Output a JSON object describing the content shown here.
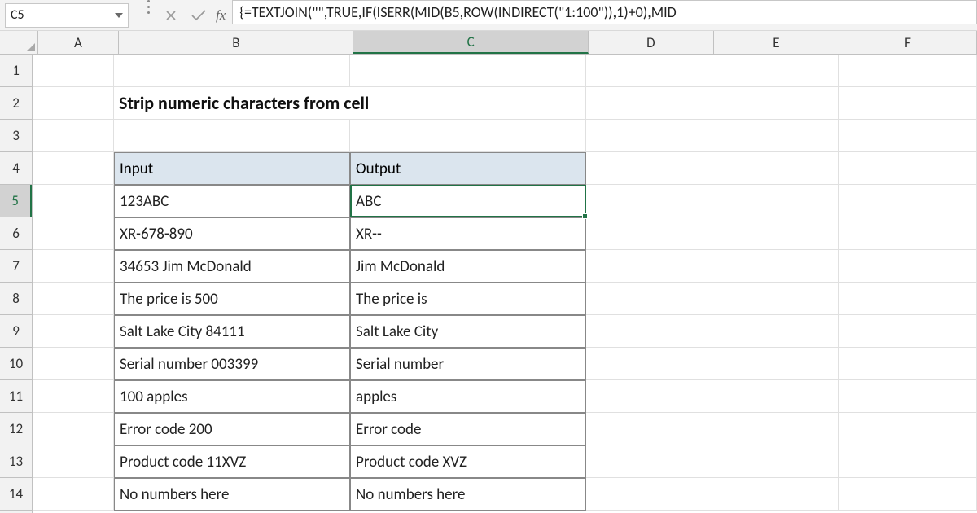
{
  "name_box": {
    "value": "C5"
  },
  "formula_bar": {
    "fx_label": "fx",
    "value": "{=TEXTJOIN(\"\",TRUE,IF(ISERR(MID(B5,ROW(INDIRECT(\"1:100\")),1)+0),MID"
  },
  "columns": {
    "A": "A",
    "B": "B",
    "C": "C",
    "D": "D",
    "E": "E",
    "F": "F"
  },
  "rows": {
    "r1": "1",
    "r2": "2",
    "r3": "3",
    "r4": "4",
    "r5": "5",
    "r6": "6",
    "r7": "7",
    "r8": "8",
    "r9": "9",
    "r10": "10",
    "r11": "11",
    "r12": "12",
    "r13": "13",
    "r14": "14"
  },
  "title": "Strip numeric characters from cell",
  "table": {
    "header": {
      "input": "Input",
      "output": "Output"
    },
    "rows": [
      {
        "input": "123ABC",
        "output": "ABC"
      },
      {
        "input": "XR-678-890",
        "output": "XR--"
      },
      {
        "input": "34653 Jim McDonald",
        "output": " Jim McDonald"
      },
      {
        "input": "The price is 500",
        "output": "The price is"
      },
      {
        "input": "Salt Lake City 84111",
        "output": "Salt Lake City"
      },
      {
        "input": "Serial number 003399",
        "output": "Serial number"
      },
      {
        "input": "100 apples",
        "output": " apples"
      },
      {
        "input": "Error code 200",
        "output": "Error code"
      },
      {
        "input": "Product code 11XVZ",
        "output": "Product code XVZ"
      },
      {
        "input": "No numbers here",
        "output": "No numbers here"
      }
    ]
  },
  "colors": {
    "accent": "#217346",
    "header_fill": "#dbe5ee"
  }
}
